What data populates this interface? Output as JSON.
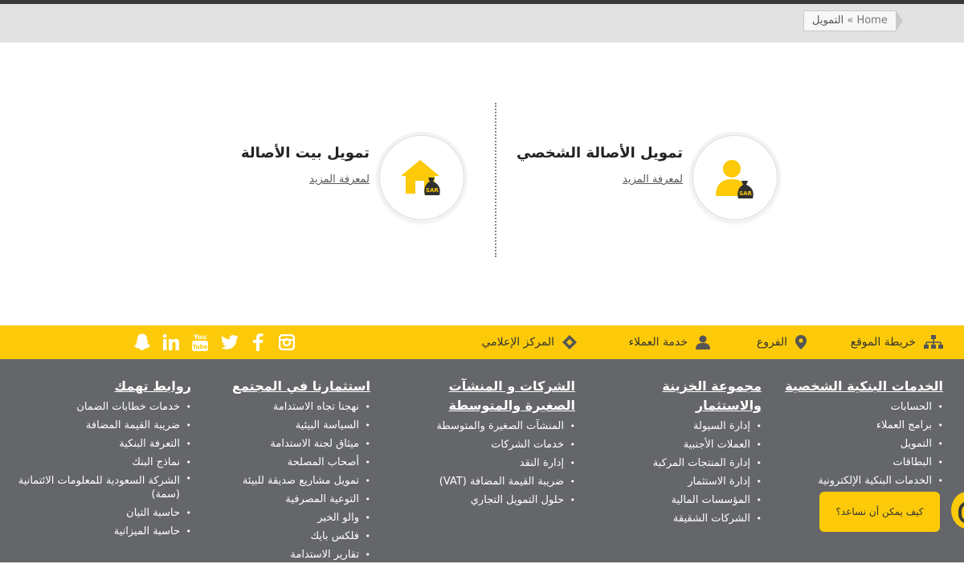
{
  "breadcrumb": {
    "home": "Home",
    "separator": "»",
    "current": "التمويل"
  },
  "products": [
    {
      "title": "تمويل الأصالة الشخصي",
      "link": "لمعرفة المزيد",
      "icon": "person-sar-icon"
    },
    {
      "title": "تمويل بيت الأصالة",
      "link": "لمعرفة المزيد",
      "icon": "house-sar-icon"
    }
  ],
  "icon_badge": "SAR",
  "yellow_bar": {
    "links": [
      {
        "label": "خريطة الموقع",
        "icon": "sitemap-icon"
      },
      {
        "label": "الفروع",
        "icon": "map-pin-icon"
      },
      {
        "label": "خدمة العملاء",
        "icon": "user-icon"
      },
      {
        "label": "المركز الإعلامي",
        "icon": "diamond-icon"
      }
    ],
    "social": [
      "instagram-icon",
      "facebook-icon",
      "twitter-icon",
      "youtube-icon",
      "linkedin-icon",
      "snapchat-icon"
    ]
  },
  "footer": {
    "columns": [
      {
        "title": "الخدمات البنكية الشخصية",
        "items": [
          "الحسابات",
          "برامج العملاء",
          "التمويل",
          "البطاقات",
          "الخدمات البنكية الإلكترونية"
        ]
      },
      {
        "title": "مجموعة الخزينة والاستثمار",
        "items": [
          "إدارة السيولة",
          "العملات الأجنبية",
          "إدارة المنتجات المركبة",
          "إدارة الاستثمار",
          "المؤسسات المالية",
          "الشركات الشقيقة"
        ]
      },
      {
        "title": "الشركات و المنشآت الصغيرة والمتوسطة",
        "items": [
          "المنشآت الصغيرة والمتوسطة",
          "خدمات الشركات",
          "إدارة النقد",
          "ضريبة القيمة المضافة (VAT)",
          "حلول التمويل التجاري"
        ]
      },
      {
        "title": "استثمارنا في المجتمع",
        "items": [
          "نهجنا تجاه الاستدامة",
          "السياسة البيئية",
          "ميثاق لجنة الاستدامة",
          "أصحاب المصلحة",
          "تمويل مشاريع صديقة للبيئة",
          "التوعية المصرفية",
          "والو الخير",
          "فلكس بايك",
          "تقارير الاستدامة"
        ]
      },
      {
        "title": "روابط تهمك",
        "items": [
          "خدمات خطابات الضمان",
          "ضريبة القيمة المضافة",
          "التعرفة البنكية",
          "نماذج البنك",
          "الشركة السعودية للمعلومات الائتمانية (سمة)",
          "حاسبة التيان",
          "حاسبة الميزانية"
        ]
      }
    ]
  },
  "chat": {
    "prompt": "كيف يمكن أن نساعد؟"
  },
  "colors": {
    "accent": "#fcca08",
    "footer_bg": "#646669",
    "bread_bg": "#e2e2e2"
  }
}
